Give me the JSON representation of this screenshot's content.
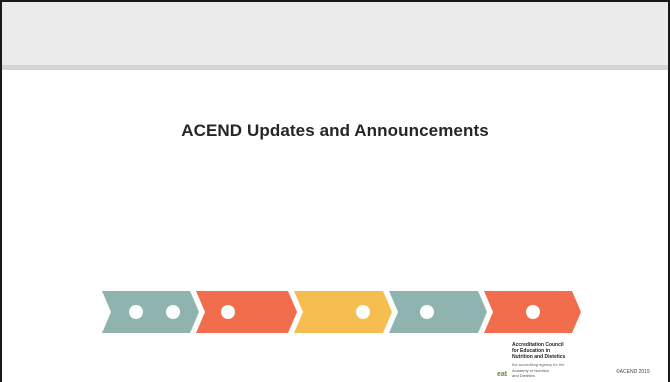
{
  "slide": {
    "title": "ACEND Updates and Announcements"
  },
  "chevrons": [
    {
      "color": "#8fb3ae",
      "dots": 2
    },
    {
      "color": "#f26d4b",
      "dots": 1
    },
    {
      "color": "#f6bd51",
      "dots": 1
    },
    {
      "color": "#8fb3ae",
      "dots": 1
    },
    {
      "color": "#f26d4b",
      "dots": 1
    }
  ],
  "footer": {
    "logo_line1": "Accreditation Council",
    "logo_line2": "for Education in",
    "logo_line3": "Nutrition and Dietetics",
    "logo_sub": "the accrediting agency for the",
    "logo_academy_line1": "Academy of Nutrition",
    "logo_academy_line2": "and Dietetics",
    "copyright": "©ACEND 2019"
  },
  "colors": {
    "header_band": "#ebebeb",
    "header_rule": "#d4d4d4",
    "title_text": "#262626",
    "logo_mark": "#5a8a3c"
  }
}
